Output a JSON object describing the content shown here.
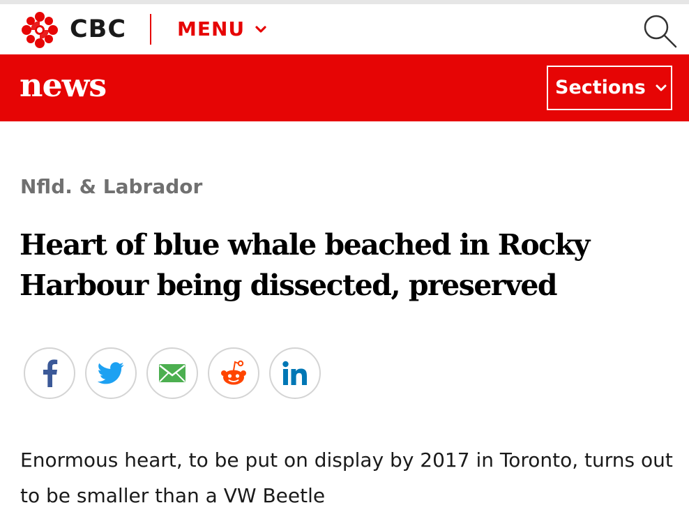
{
  "header": {
    "brand": "CBC",
    "menu_label": "MENU",
    "search_icon": "search-icon",
    "accent_color": "#e60505"
  },
  "news_bar": {
    "title": "news",
    "sections_label": "Sections"
  },
  "article": {
    "section": "Nfld. & Labrador",
    "headline": "Heart of blue whale beached in Rocky Harbour being dissected, preserved",
    "deck": "Enormous heart, to be put on display by 2017 in Toronto, turns out to be smaller than a VW Beetle"
  },
  "share": {
    "icons": [
      "facebook-icon",
      "twitter-icon",
      "email-icon",
      "reddit-icon",
      "linkedin-icon"
    ],
    "colors": {
      "facebook": "#3b5998",
      "twitter": "#1da1f2",
      "email": "#4caf50",
      "reddit": "#ff4500",
      "linkedin": "#0077b5"
    }
  }
}
